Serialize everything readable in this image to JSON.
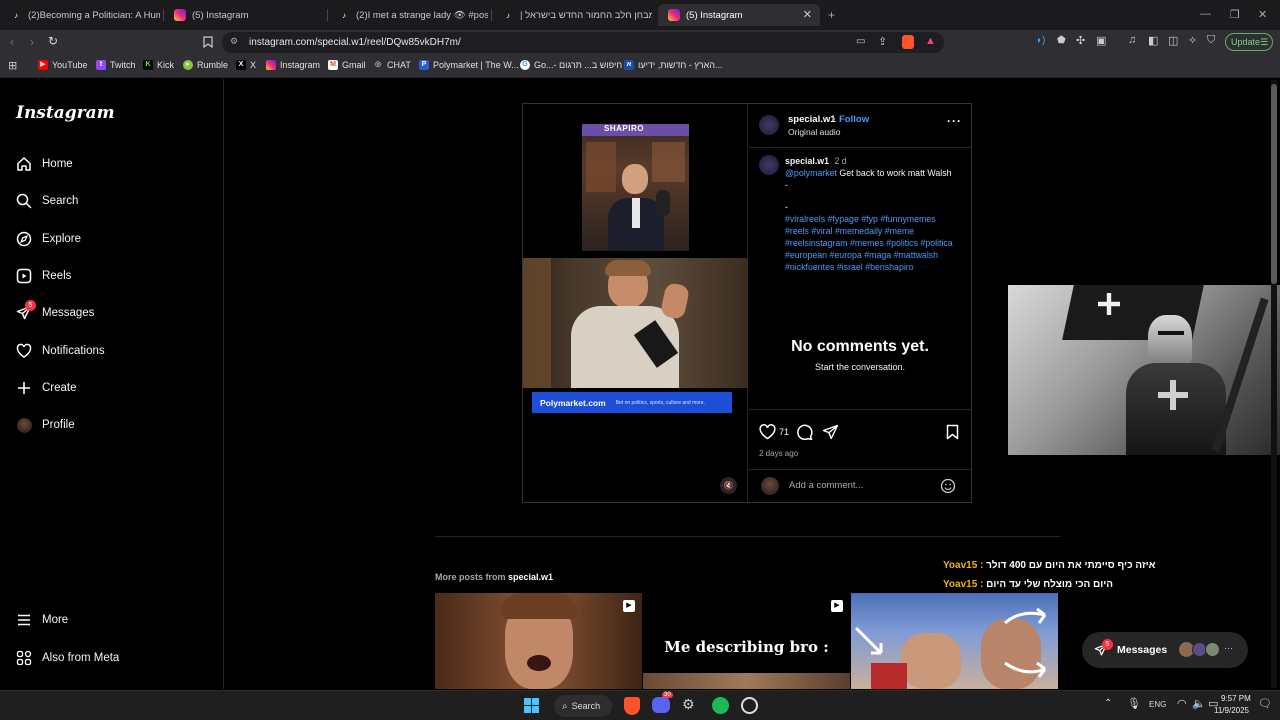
{
  "browser": {
    "tabs": [
      {
        "label": "(2)Becoming a Politician: A Humorou",
        "icon": "tiktok-icon"
      },
      {
        "label": "(5) Instagram",
        "icon": "instagram-icon"
      },
      {
        "label": "(2)I met a strange lady 👁 #postman",
        "icon": "tiktok-icon"
      },
      {
        "label": "(2)מבחן חלב החמור החדש בישראל |",
        "icon": "tiktok-icon"
      },
      {
        "label": "(5) Instagram",
        "icon": "instagram-icon"
      }
    ],
    "url": "instagram.com/special.w1/reel/DQw85vkDH7m/",
    "update_label": "Update",
    "bookmarks": [
      {
        "label": "YouTube",
        "color": "#ff0000"
      },
      {
        "label": "Twitch",
        "color": "#9146ff"
      },
      {
        "label": "Kick",
        "color": "#53fc18"
      },
      {
        "label": "Rumble",
        "color": "#85c742"
      },
      {
        "label": "X",
        "color": "#000000"
      },
      {
        "label": "Instagram",
        "color": "#d62976"
      },
      {
        "label": "Gmail",
        "color": "#ea4335"
      },
      {
        "label": "CHAT",
        "color": "#777777"
      },
      {
        "label": "Polymarket | The W...",
        "color": "#2d5bd8"
      },
      {
        "label": "Go...- חיפוש ב... תרגום",
        "color": "#4285f4"
      },
      {
        "label": "הארץ - חדשות, ידיעו...",
        "color": "#1c4fa0"
      }
    ]
  },
  "instagram": {
    "logo": "Instagram",
    "nav": [
      {
        "label": "Home",
        "icon": "home-icon"
      },
      {
        "label": "Search",
        "icon": "search-icon"
      },
      {
        "label": "Explore",
        "icon": "explore-icon"
      },
      {
        "label": "Reels",
        "icon": "reels-icon"
      },
      {
        "label": "Messages",
        "icon": "messages-icon",
        "badge": "5"
      },
      {
        "label": "Notifications",
        "icon": "heart-icon"
      },
      {
        "label": "Create",
        "icon": "plus-icon"
      },
      {
        "label": "Profile",
        "icon": "avatar"
      }
    ],
    "nav_bottom": [
      {
        "label": "More",
        "icon": "menu-icon"
      },
      {
        "label": "Also from Meta",
        "icon": "meta-icon"
      }
    ],
    "post": {
      "username": "special.w1",
      "follow": "Follow",
      "dot": "•",
      "audio": "Original audio",
      "caption_user": "special.w1",
      "caption_time": "2 d",
      "mention": "@polymarket",
      "caption_text": "Get back to work matt Walsh",
      "dash1": "-",
      "dash2": "-",
      "hashtags": "#viralreels #fypage #fyp #funnymemes #reels #viral #memedaily #meme #reelsinstagram #memes #politics #politica #european #europa  #maga #mattwalsh #nickfuentes #israel #benshapiro",
      "no_comments": "No comments yet.",
      "start_conv": "Start the conversation.",
      "likes": "71",
      "time_ago": "2 days ago",
      "comment_placeholder": "Add a comment...",
      "media_banner_brand": "Polymarket.com",
      "media_banner_tagline": "Bet on politics, sports, culture and more.",
      "shapiro_label": "SHAPIRO"
    },
    "more_posts_prefix": "More posts from",
    "more_posts_user": "special.w1",
    "tile_text": "Me describing bro :",
    "messages_label": "Messages",
    "messages_badge": "5"
  },
  "overlay_chat": [
    {
      "user": "Yoav15 :",
      "text": "איזה כיף סיימתי את היום עם 400 דולר"
    },
    {
      "user": "Yoav15 :",
      "text": "היום הכי מוצלח שלי עד היום"
    }
  ],
  "taskbar": {
    "search_label": "Search",
    "lang": "ENG",
    "time": "9:57 PM",
    "date": "11/9/2025",
    "discord_badge": "30"
  }
}
